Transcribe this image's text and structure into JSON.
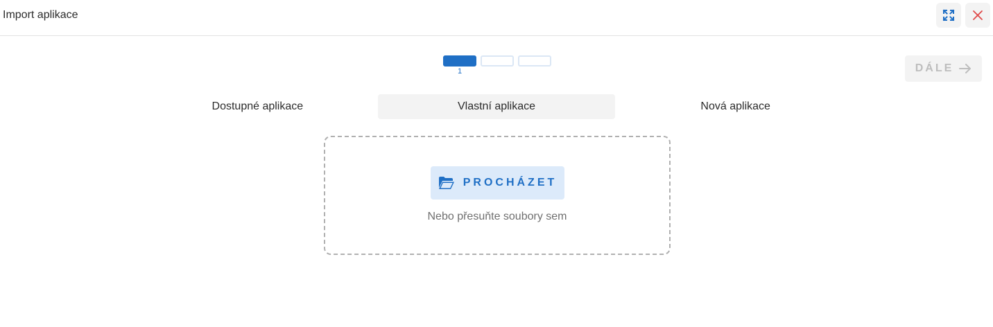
{
  "header": {
    "title": "Import aplikace",
    "expand_icon": "expand-icon",
    "close_icon": "close-icon"
  },
  "stepper": {
    "current_label": "1",
    "current_step": 1,
    "total_steps": 3
  },
  "next_button": {
    "label": "DÁLE",
    "icon": "arrow-right-icon",
    "enabled": false
  },
  "tabs": [
    {
      "label": "Dostupné aplikace",
      "active": false
    },
    {
      "label": "Vlastní aplikace",
      "active": true
    },
    {
      "label": "Nová aplikace",
      "active": false
    }
  ],
  "dropzone": {
    "browse_label": "PROCHÁZET",
    "browse_icon": "folder-open-icon",
    "hint": "Nebo přesuňte soubory sem"
  },
  "colors": {
    "accent": "#1f6fc5",
    "accent_light": "#dceafa",
    "close": "#e04848",
    "disabled": "#bdbdbd"
  }
}
